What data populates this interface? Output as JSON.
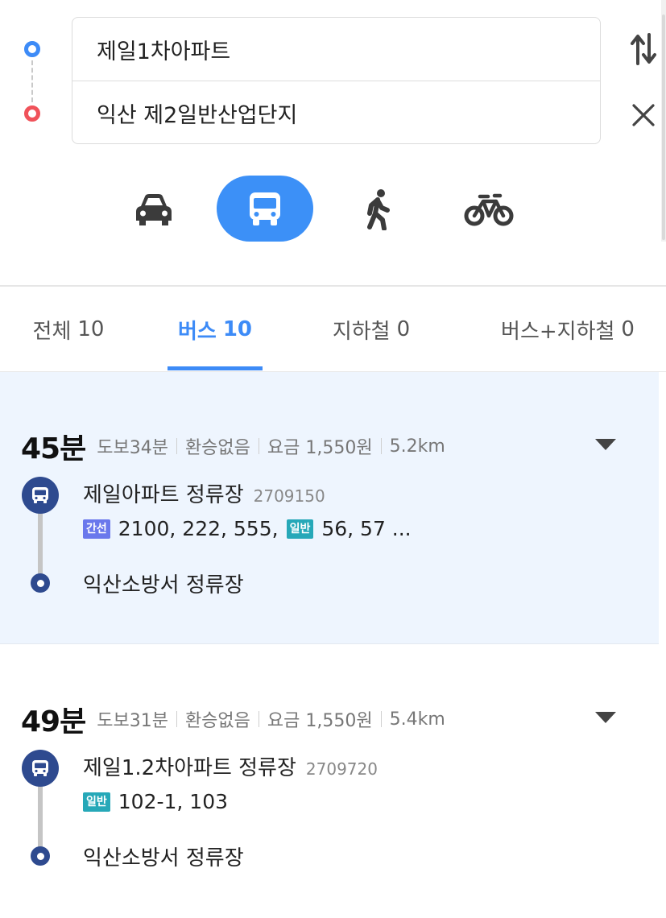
{
  "search": {
    "origin": "제일1차아파트",
    "destination": "익산 제2일반산업단지"
  },
  "modes": [
    {
      "name": "car",
      "icon": "car-icon",
      "active": false
    },
    {
      "name": "bus",
      "icon": "bus-icon",
      "active": true
    },
    {
      "name": "walk",
      "icon": "walk-icon",
      "active": false
    },
    {
      "name": "bike",
      "icon": "bike-icon",
      "active": false
    }
  ],
  "tabs": [
    {
      "label": "전체",
      "count": "10",
      "active": false
    },
    {
      "label": "버스",
      "count": "10",
      "active": true
    },
    {
      "label": "지하철",
      "count": "0",
      "active": false
    },
    {
      "label": "버스+지하철",
      "count": "0",
      "active": false
    }
  ],
  "colors": {
    "accent": "#3d8bf7",
    "origin_dot": "#3d8bf7",
    "destination_dot": "#f0525a",
    "selected_card_bg": "#eef5fe",
    "stop_marker": "#2e4a8f",
    "badge_trunk": "#6a78ec",
    "badge_general": "#26a8b8"
  },
  "routes": [
    {
      "total_time": "45분",
      "walk": "도보34분",
      "transfer": "환승없음",
      "fare": "요금 1,550원",
      "distance": "5.2km",
      "board_stop": "제일아파트 정류장",
      "board_stop_id": "2709150",
      "badge_1": "간선",
      "lines_1": "2100, 222, 555,",
      "badge_2": "일반",
      "lines_2": "56, 57 ...",
      "alight_stop": "익산소방서 정류장"
    },
    {
      "total_time": "49분",
      "walk": "도보31분",
      "transfer": "환승없음",
      "fare": "요금 1,550원",
      "distance": "5.4km",
      "board_stop": "제일1.2차아파트 정류장",
      "board_stop_id": "2709720",
      "badge_1": "일반",
      "lines_1": "102-1, 103",
      "alight_stop": "익산소방서 정류장"
    }
  ]
}
